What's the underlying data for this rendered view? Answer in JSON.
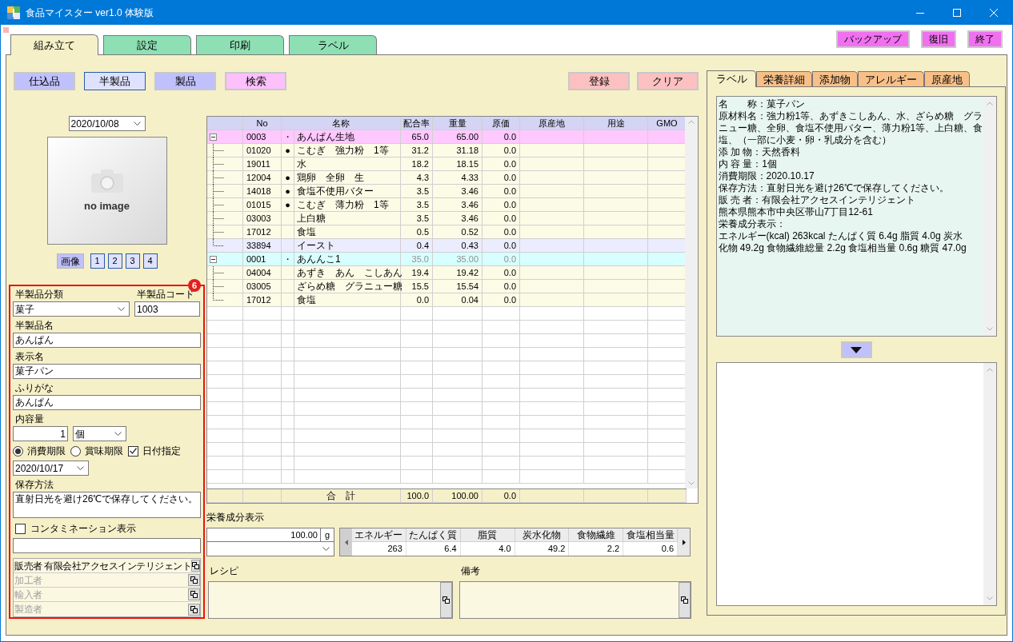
{
  "window": {
    "title": "食品マイスター ver1.0 体験版"
  },
  "main_tabs": [
    {
      "label": "組み立て",
      "selected": true
    },
    {
      "label": "設定",
      "selected": false
    },
    {
      "label": "印刷",
      "selected": false
    },
    {
      "label": "ラベル",
      "selected": false
    }
  ],
  "system_buttons": [
    "バックアップ",
    "復旧",
    "終了"
  ],
  "mode_buttons": [
    {
      "label": "仕込品",
      "selected": false
    },
    {
      "label": "半製品",
      "selected": true
    },
    {
      "label": "製品",
      "selected": false
    }
  ],
  "search_button": "検索",
  "action_buttons": [
    "登録",
    "クリア"
  ],
  "image": {
    "date": "2020/10/08",
    "placeholder": "no image",
    "button": "画像",
    "pages": [
      "1",
      "2",
      "3",
      "4"
    ]
  },
  "badge": "6",
  "form": {
    "category": {
      "label": "半製品分類",
      "value": "菓子"
    },
    "code": {
      "label": "半製品コード",
      "value": "1003"
    },
    "texts": [
      {
        "label": "半製品名",
        "value": "あんぱん"
      },
      {
        "label": "表示名",
        "value": "菓子パン"
      },
      {
        "label": "ふりがな",
        "value": "あんぱん"
      }
    ],
    "quantity": {
      "label": "内容量",
      "value": "1",
      "unit": "個"
    },
    "expiry_types": [
      {
        "label": "消費期限",
        "selected": true
      },
      {
        "label": "賞味期限",
        "selected": false
      }
    ],
    "date_specified": {
      "label": "日付指定",
      "checked": true
    },
    "expiry_date": "2020/10/17",
    "storage": {
      "label": "保存方法",
      "value": "直射日光を避け26℃で保存してください。"
    },
    "contamination": {
      "label": "コンタミネーション表示",
      "checked": false
    },
    "parties": [
      {
        "label": "販売者",
        "value": "有限会社アクセスインテリジェント"
      },
      {
        "label": "加工者"
      },
      {
        "label": "輸入者"
      },
      {
        "label": "製造者"
      }
    ]
  },
  "table": {
    "columns": [
      "No",
      "名称",
      "配合率",
      "重量",
      "原価",
      "原産地",
      "用途",
      "GMO"
    ],
    "groups": [
      {
        "no": "0003",
        "mark": "・",
        "name": "あんぱん生地",
        "ratio": "65.0",
        "weight": "65.00",
        "cost": "0.0",
        "color": "#ffc8ff",
        "dimmed": false,
        "expanded": true,
        "children": [
          {
            "no": "01020",
            "mark": "●",
            "name": "こむぎ　強力粉　1等",
            "ratio": "31.2",
            "weight": "31.18",
            "cost": "0.0",
            "selected": false
          },
          {
            "no": "19011",
            "name": "水",
            "ratio": "18.2",
            "weight": "18.15",
            "cost": "0.0",
            "selected": false
          },
          {
            "no": "12004",
            "mark": "●",
            "name": "鶏卵　全卵　生",
            "ratio": "4.3",
            "weight": "4.33",
            "cost": "0.0",
            "selected": false
          },
          {
            "no": "14018",
            "mark": "●",
            "name": "食塩不使用バター",
            "ratio": "3.5",
            "weight": "3.46",
            "cost": "0.0",
            "selected": false
          },
          {
            "no": "01015",
            "mark": "●",
            "name": "こむぎ　薄力粉　1等",
            "ratio": "3.5",
            "weight": "3.46",
            "cost": "0.0",
            "selected": false
          },
          {
            "no": "03003",
            "name": "上白糖",
            "ratio": "3.5",
            "weight": "3.46",
            "cost": "0.0",
            "selected": false
          },
          {
            "no": "17012",
            "name": "食塩",
            "ratio": "0.5",
            "weight": "0.52",
            "cost": "0.0",
            "selected": false
          },
          {
            "no": "33894",
            "name": "イースト",
            "ratio": "0.4",
            "weight": "0.43",
            "cost": "0.0",
            "selected": true
          }
        ]
      },
      {
        "no": "0001",
        "mark": "・",
        "name": "あんんこ1",
        "ratio": "35.0",
        "weight": "35.00",
        "cost": "0.0",
        "color": "#d8ffff",
        "dimmed": true,
        "expanded": true,
        "children": [
          {
            "no": "04004",
            "name": "あずき　あん　こしあん",
            "ratio": "19.4",
            "weight": "19.42",
            "cost": "0.0",
            "selected": false
          },
          {
            "no": "03005",
            "name": "ざらめ糖　グラニュー糖",
            "ratio": "15.5",
            "weight": "15.54",
            "cost": "0.0",
            "selected": false
          },
          {
            "no": "17012",
            "name": "食塩",
            "ratio": "0.0",
            "weight": "0.04",
            "cost": "0.0",
            "selected": false
          }
        ]
      }
    ],
    "total": {
      "label": "合　計",
      "ratio": "100.0",
      "weight": "100.00",
      "cost": "0.0"
    }
  },
  "nutrition": {
    "label": "栄養成分表示",
    "amount": "100.00",
    "unit": "g",
    "columns": [
      "エネルギー",
      "たんぱく質",
      "脂質",
      "炭水化物",
      "食物繊維",
      "食塩相当量"
    ],
    "values": [
      "263",
      "6.4",
      "4.0",
      "49.2",
      "2.2",
      "0.6"
    ]
  },
  "recipe": {
    "label": "レシピ"
  },
  "notes": {
    "label": "備考"
  },
  "side_tabs": [
    {
      "label": "ラベル",
      "selected": true
    },
    {
      "label": "栄養詳細",
      "selected": false
    },
    {
      "label": "添加物",
      "selected": false
    },
    {
      "label": "アレルギー",
      "selected": false
    },
    {
      "label": "原産地",
      "selected": false
    }
  ],
  "label_text": [
    "名　　称：菓子パン",
    "原材料名：強力粉1等、あずきこしあん、水、ざらめ糖　グラ",
    "ニュー糖、全卵、食塩不使用バター、薄力粉1等、上白糖、食",
    "塩、（一部に小麦・卵・乳成分を含む）",
    "添 加 物：天然香料",
    "内 容 量：1個",
    "消費期限：2020.10.17",
    "保存方法：直射日光を避け26℃で保存してください。",
    "販 売 者：有限会社アクセスインテリジェント",
    "熊本県熊本市中央区帯山7丁目12-61",
    "栄養成分表示：",
    "エネルギー(kcal) 263kcal たんぱく質 6.4g 脂質 4.0g 炭水",
    "化物 49.2g 食物繊維総量 2.2g 食塩相当量 0.6g 糖質 47.0g"
  ]
}
